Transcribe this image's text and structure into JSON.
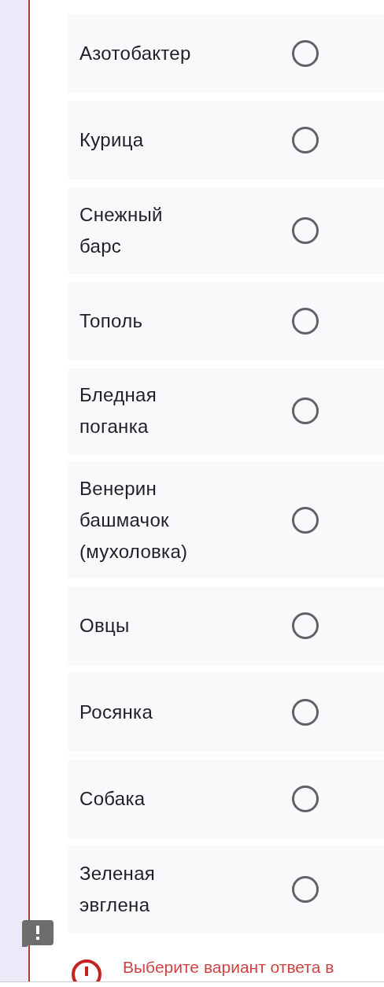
{
  "options": [
    {
      "label": "Азотобактер",
      "selected": false
    },
    {
      "label": "Курица",
      "selected": false
    },
    {
      "label": "Снежный барс",
      "selected": false
    },
    {
      "label": "Тополь",
      "selected": false
    },
    {
      "label": "Бледная поганка",
      "selected": false
    },
    {
      "label": "Венерин башмачок (мухоловка)",
      "selected": false
    },
    {
      "label": "Овцы",
      "selected": false
    },
    {
      "label": "Росянка",
      "selected": false
    },
    {
      "label": "Собака",
      "selected": false
    },
    {
      "label": "Зеленая эвглена",
      "selected": false
    }
  ],
  "error": {
    "message": "Выберите вариант ответа в"
  }
}
